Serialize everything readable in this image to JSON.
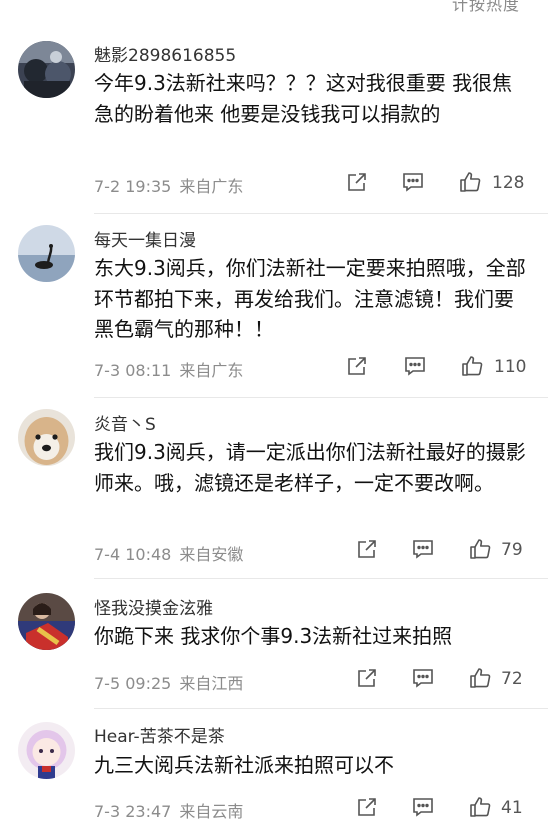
{
  "header": {
    "sort_hint": "计按热度"
  },
  "colors": {
    "text": "#111111",
    "meta": "#8c8c8c",
    "icon": "#555555",
    "divider": "#e8e8e8"
  },
  "comments": [
    {
      "username": "魅影2898616855",
      "text": "今年9.3法新社来吗？？？这对我很重要 我很焦急的盼着他来 他要是没钱我可以捐款的",
      "time": "7-2 19:35",
      "location": "来自广东",
      "likes": "128"
    },
    {
      "username": "每天一集日漫",
      "text": "东大9.3阅兵，你们法新社一定要来拍照哦，全部环节都拍下来，再发给我们。注意滤镜！我们要黑色霸气的那种！！",
      "time": "7-3 08:11",
      "location": "来自广东",
      "likes": "110"
    },
    {
      "username": "炎音丶S",
      "text": "我们9.3阅兵，请一定派出你们法新社最好的摄影师来。哦，滤镜还是老样子，一定不要改啊。",
      "time": "7-4 10:48",
      "location": "来自安徽",
      "likes": "79"
    },
    {
      "username": "怪我没摸金泫雅",
      "text": "你跪下来 我求你个事9.3法新社过来拍照",
      "time": "7-5 09:25",
      "location": "来自江西",
      "likes": "72"
    },
    {
      "username": "Hear-苦茶不是茶",
      "text": "九三大阅兵法新社派来拍照可以不",
      "time": "7-3 23:47",
      "location": "来自云南",
      "likes": "41"
    }
  ]
}
